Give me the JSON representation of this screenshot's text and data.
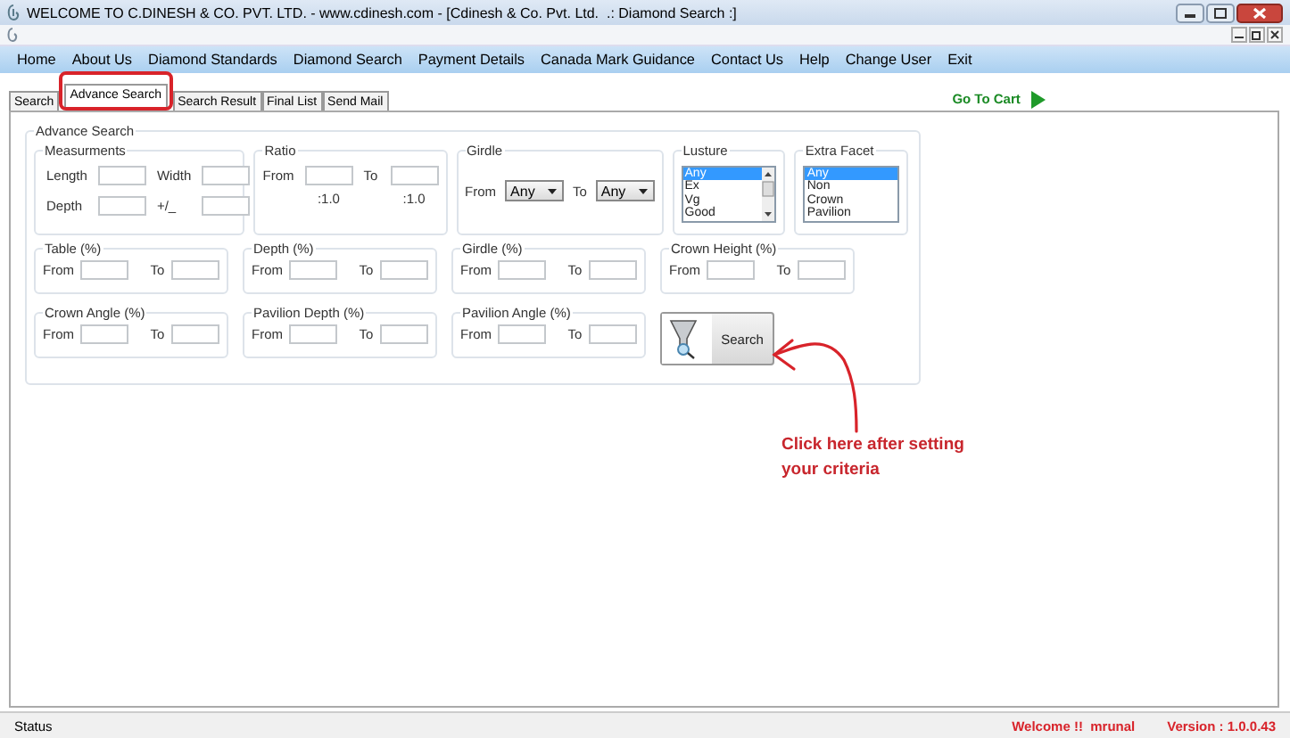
{
  "window": {
    "title": "WELCOME TO C.DINESH & CO. PVT. LTD. - www.cdinesh.com - [Cdinesh & Co. Pvt. Ltd.  .: Diamond Search :]"
  },
  "menu": [
    "Home",
    "About Us",
    "Diamond Standards",
    "Diamond Search",
    "Payment Details",
    "Canada Mark Guidance",
    "Contact Us",
    "Help",
    "Change User",
    "Exit"
  ],
  "tabs": [
    {
      "label": "Search",
      "selected": false
    },
    {
      "label": "Advance Search",
      "selected": true
    },
    {
      "label": "Search Result",
      "selected": false
    },
    {
      "label": "Final List",
      "selected": false
    },
    {
      "label": "Send Mail",
      "selected": false
    }
  ],
  "go_to_cart": "Go To Cart",
  "advance_search": {
    "title": "Advance Search",
    "measurements": {
      "title": "Measurments",
      "fields": [
        "Length",
        "Width",
        "Depth",
        "+/_"
      ]
    },
    "ratio": {
      "title": "Ratio",
      "from": "From",
      "to": "To",
      "suffixes": [
        ":1.0",
        ":1.0"
      ]
    },
    "girdle": {
      "title": "Girdle",
      "from": "From",
      "to": "To",
      "from_value": "Any",
      "to_value": "Any"
    },
    "lists": [
      {
        "title": "Lusture",
        "scrollable": true,
        "options": [
          {
            "label": "Any",
            "selected": true
          },
          {
            "label": "Ex",
            "selected": false
          },
          {
            "label": "Vg",
            "selected": false
          },
          {
            "label": "Good",
            "selected": false
          }
        ]
      },
      {
        "title": "Extra Facet",
        "scrollable": false,
        "options": [
          {
            "label": "Any",
            "selected": true
          },
          {
            "label": "Non",
            "selected": false
          },
          {
            "label": "Crown",
            "selected": false
          },
          {
            "label": "Pavilion",
            "selected": false
          }
        ]
      }
    ],
    "ranges": [
      {
        "title": "Table (%)",
        "from": "From",
        "to": "To"
      },
      {
        "title": "Depth (%)",
        "from": "From",
        "to": "To"
      },
      {
        "title": "Girdle (%)",
        "from": "From",
        "to": "To"
      },
      {
        "title": "Crown Height (%)",
        "from": "From",
        "to": "To"
      },
      {
        "title": "Crown Angle (%)",
        "from": "From",
        "to": "To"
      },
      {
        "title": "Pavilion Depth (%)",
        "from": "From",
        "to": "To"
      },
      {
        "title": "Pavilion Angle (%)",
        "from": "From",
        "to": "To"
      }
    ],
    "search_button": "Search"
  },
  "annotation": "Click here after setting your criteria",
  "status_bar": {
    "status": "Status",
    "welcome": "Welcome !!  mrunal",
    "version": "Version : 1.0.0.43"
  }
}
